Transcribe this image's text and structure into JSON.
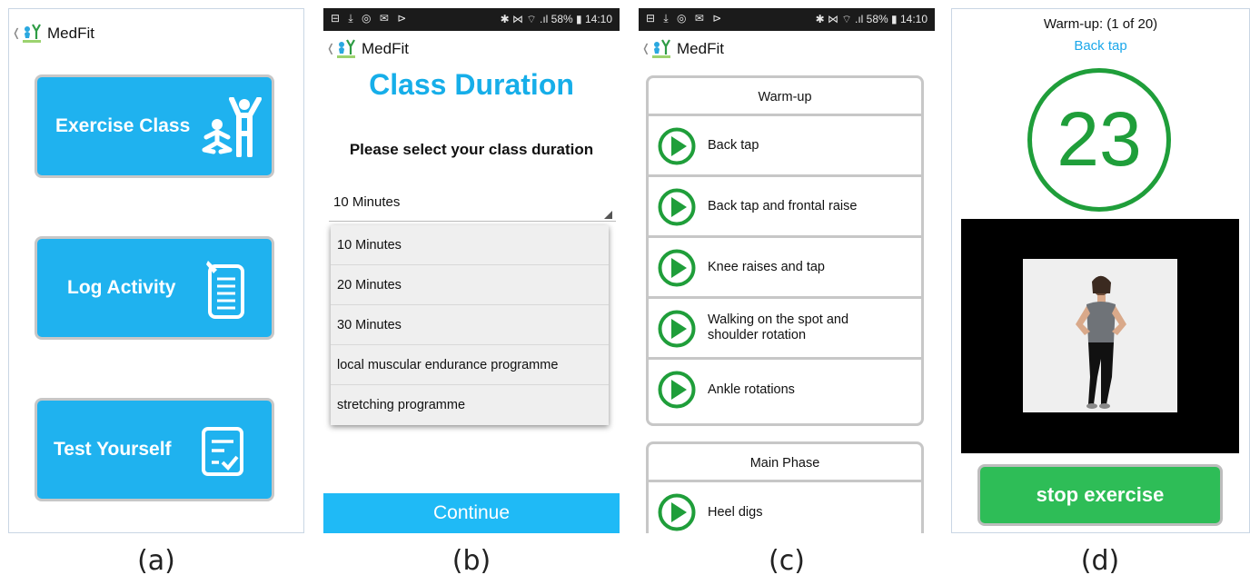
{
  "app": {
    "title": "MedFit"
  },
  "captions": {
    "a": "(a)",
    "b": "(b)",
    "c": "(c)",
    "d": "(d)"
  },
  "statusbar": {
    "icons_left": "⊟ ⤓ ◎ ✉ ⊳",
    "icons_right": "✱ ⋈ ⌔ .ıl 58% ▮ 14:10"
  },
  "panel_a": {
    "buttons": [
      "Exercise Class",
      "Log Activity",
      "Test Yourself"
    ],
    "icons": [
      "exercise-figures-icon",
      "clipboard-list-icon",
      "checklist-icon"
    ]
  },
  "panel_b": {
    "title": "Class Duration",
    "prompt": "Please select your class duration",
    "selected": "10 Minutes",
    "options": [
      "10 Minutes",
      "20 Minutes",
      "30 Minutes",
      "local muscular endurance programme",
      "stretching programme"
    ],
    "continue": "Continue"
  },
  "panel_c": {
    "groups": [
      {
        "name": "Warm-up",
        "exercises": [
          "Back tap",
          "Back tap and frontal raise",
          "Knee raises and tap",
          "Walking on the spot and shoulder rotation",
          "Ankle rotations"
        ]
      },
      {
        "name": "Main Phase",
        "exercises": [
          "Heel digs"
        ]
      }
    ]
  },
  "panel_d": {
    "phase": "Warm-up: (1 of 20)",
    "exercise": "Back tap",
    "countdown": "23",
    "stop": "stop exercise"
  },
  "colors": {
    "accent_blue": "#1fb2ef",
    "green": "#1f9e3a",
    "stop_green": "#2ebd57"
  }
}
